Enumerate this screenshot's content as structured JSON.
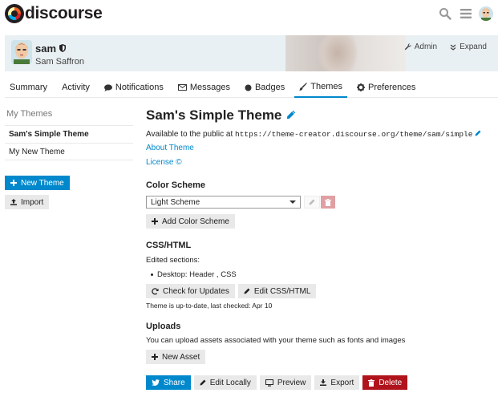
{
  "header": {
    "logo_text": "discourse",
    "icons": [
      "search-icon",
      "hamburger-icon",
      "user-avatar"
    ]
  },
  "profile": {
    "username": "sam",
    "full_name": "Sam Saffron",
    "admin_label": "Admin",
    "expand_label": "Expand"
  },
  "nav": {
    "items": [
      {
        "label": "Summary",
        "icon": ""
      },
      {
        "label": "Activity",
        "icon": ""
      },
      {
        "label": "Notifications",
        "icon": "comment-icon"
      },
      {
        "label": "Messages",
        "icon": "envelope-icon"
      },
      {
        "label": "Badges",
        "icon": "circle-icon"
      },
      {
        "label": "Themes",
        "icon": "paintbrush-icon",
        "active": true
      },
      {
        "label": "Preferences",
        "icon": "gear-icon"
      }
    ]
  },
  "sidebar": {
    "heading": "My Themes",
    "themes": [
      "Sam's Simple Theme",
      "My New Theme"
    ],
    "new_theme_label": "New Theme",
    "import_label": "Import"
  },
  "theme": {
    "title": "Sam's Simple Theme",
    "available_prefix": "Available to the public at",
    "public_url": "https://theme-creator.discourse.org/theme/sam/simple",
    "about_link": "About Theme",
    "license_link": "License ©",
    "color_scheme_heading": "Color Scheme",
    "color_scheme_selected": "Light Scheme",
    "add_color_scheme_label": "Add Color Scheme",
    "css_html_heading": "CSS/HTML",
    "edited_sections_label": "Edited sections:",
    "edited_sections_item": "Desktop: Header , CSS",
    "check_updates_label": "Check for Updates",
    "edit_css_label": "Edit CSS/HTML",
    "update_status": "Theme is up-to-date, last checked: Apr 10",
    "uploads_heading": "Uploads",
    "uploads_desc": "You can upload assets associated with your theme such as fonts and images",
    "new_asset_label": "New Asset",
    "share_label": "Share",
    "edit_locally_label": "Edit Locally",
    "preview_label": "Preview",
    "export_label": "Export",
    "delete_label": "Delete"
  },
  "colors": {
    "accent": "#0088cc",
    "danger": "#b0131b",
    "banner_bg": "#e9f0f3"
  }
}
